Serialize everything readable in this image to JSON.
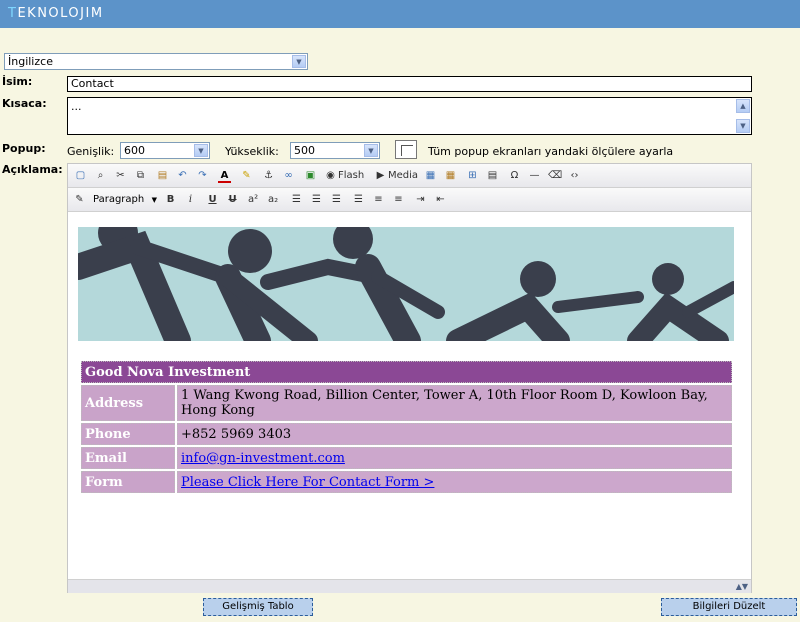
{
  "app": {
    "logo_first": "T",
    "logo_rest": "EKNOLOJIM"
  },
  "language": {
    "selected": "İngilizce"
  },
  "form": {
    "isim_label": "İsim:",
    "isim_value": "Contact",
    "kisaca_label": "Kısaca:",
    "kisaca_value": "...",
    "popup_label": "Popup:",
    "width_label": "Genişlik:",
    "width_value": "600",
    "height_label": "Yükseklik:",
    "height_value": "500",
    "popup_checkbox_label": "Tüm popup ekranları yandaki ölçülere ayarla",
    "aciklama_label": "Açıklama:"
  },
  "toolbar": {
    "flash_label": "Flash",
    "media_label": "Media",
    "paragraph_value": "Paragraph",
    "bold": "B",
    "italic": "i",
    "underline": "U",
    "strike": "U",
    "superscript": "a²",
    "subscript": "a₂",
    "omega": "Ω"
  },
  "info_table": {
    "company": "Good Nova Investment",
    "rows": [
      {
        "key": "Address",
        "value": "1 Wang Kwong Road, Billion Center, Tower A, 10th Floor Room D, Kowloon Bay, Hong Kong"
      },
      {
        "key": "Phone",
        "value": "+852 5969 3403"
      },
      {
        "key": "Email",
        "value": "info@gn-investment.com"
      },
      {
        "key": "Form",
        "value": "Please Click Here For Contact Form >"
      }
    ]
  },
  "buttons": {
    "advanced_table": "Gelişmiş Tablo",
    "update_info": "Bilgileri Düzelt"
  },
  "colors": {
    "topbar": "#5c93c9",
    "background": "#f7f6e2",
    "table_header": "#8b4895",
    "table_cell": "#c9a3c9"
  }
}
